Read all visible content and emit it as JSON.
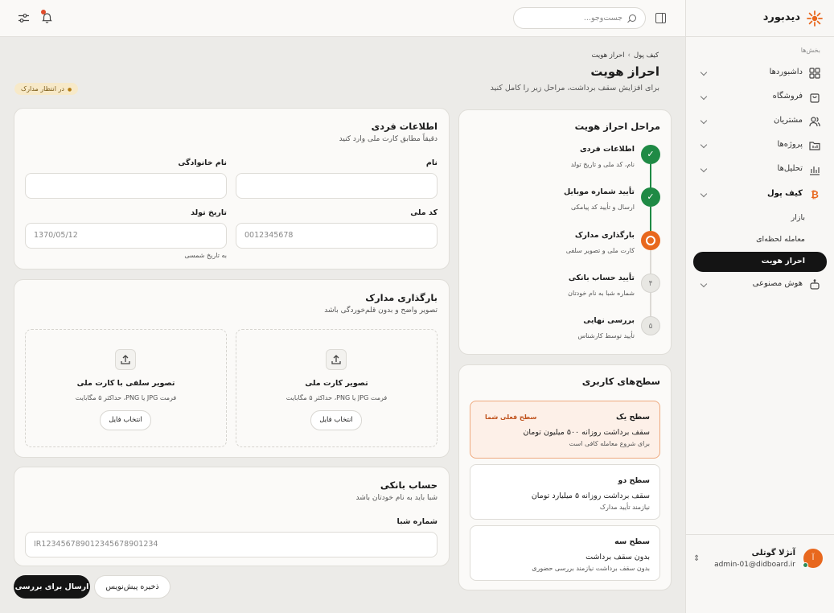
{
  "app": {
    "name": "دیدبورد"
  },
  "topbar": {
    "search_placeholder": "جست‌وجو..."
  },
  "sidebar": {
    "section": "بخش‌ها",
    "items": [
      {
        "label": "داشبوردها",
        "icon": "grid-icon"
      },
      {
        "label": "فروشگاه",
        "icon": "bag-icon"
      },
      {
        "label": "مشتریان",
        "icon": "users-icon"
      },
      {
        "label": "پروژه‌ها",
        "icon": "folder-icon"
      },
      {
        "label": "تحلیل‌ها",
        "icon": "bar-chart-icon"
      },
      {
        "label": "کیف پول",
        "icon": "bitcoin-icon"
      },
      {
        "label": "هوش مصنوعی",
        "icon": "robot-icon"
      }
    ],
    "wallet_sub": [
      {
        "label": "بازار"
      },
      {
        "label": "معامله لحظه‌ای"
      },
      {
        "label": "احراز هویت"
      }
    ],
    "user": {
      "name": "آنژلا گوتلی",
      "email": "admin-01@didboard.ir",
      "initial": "آ"
    }
  },
  "header": {
    "breadcrumb": [
      "کیف پول",
      "احراز هویت"
    ],
    "title": "احراز هویت",
    "subtitle": "برای افزایش سقف برداشت، مراحل زیر را کامل کنید",
    "status": "در انتظار مدارک"
  },
  "personal": {
    "title": "اطلاعات فردی",
    "subtitle": "دقیقاً مطابق کارت ملی وارد کنید",
    "first_name_label": "نام",
    "last_name_label": "نام خانوادگی",
    "national_id_label": "کد ملی",
    "national_id_placeholder": "0012345678",
    "birth_label": "تاریخ تولد",
    "birth_placeholder": "1370/05/12",
    "birth_hint": "به تاریخ شمسی"
  },
  "upload": {
    "title": "بارگذاری مدارک",
    "subtitle": "تصویر واضح و بدون قلم‌خوردگی باشد",
    "card1_title": "تصویر کارت ملی",
    "card1_hint": "فرمت JPG یا PNG، حداکثر ۵ مگابایت",
    "card2_title": "تصویر سلفی با کارت ملی",
    "card2_hint": "فرمت JPG یا PNG، حداکثر ۵ مگابایت",
    "choose": "انتخاب فایل"
  },
  "bank": {
    "title": "حساب بانکی",
    "subtitle": "شبا باید به نام خودتان باشد",
    "iban_label": "شماره شبا",
    "iban_placeholder": "IR123456789012345678901234"
  },
  "actions": {
    "submit": "ارسال برای بررسی",
    "draft": "ذخیره پیش‌نویس"
  },
  "steps": {
    "title": "مراحل احراز هویت",
    "items": [
      {
        "title": "اطلاعات فردی",
        "desc": "نام، کد ملی و تاریخ تولد",
        "state": "done",
        "mark": "✓"
      },
      {
        "title": "تأیید شماره موبایل",
        "desc": "ارسال و تأیید کد پیامکی",
        "state": "done",
        "mark": "✓"
      },
      {
        "title": "بارگذاری مدارک",
        "desc": "کارت ملی و تصویر سلفی",
        "state": "current",
        "mark": ""
      },
      {
        "title": "تأیید حساب بانکی",
        "desc": "شماره شبا به نام خودتان",
        "state": "pending",
        "mark": "۴"
      },
      {
        "title": "بررسی نهایی",
        "desc": "تأیید توسط کارشناس",
        "state": "pending",
        "mark": "۵"
      }
    ]
  },
  "levels": {
    "title": "سطح‌های کاربری",
    "items": [
      {
        "title": "سطح یک",
        "desc": "سقف برداشت روزانه ۵۰۰ میلیون تومان",
        "note": "برای شروع معامله کافی است",
        "badge": "سطح فعلی شما"
      },
      {
        "title": "سطح دو",
        "desc": "سقف برداشت روزانه ۵ میلیارد تومان",
        "note": "نیازمند تأیید مدارک"
      },
      {
        "title": "سطح سه",
        "desc": "بدون سقف برداشت",
        "note": "بدون سقف برداشت نیازمند بررسی حضوری"
      }
    ]
  },
  "colors": {
    "accent": "#e8681e",
    "success": "#1f8a45",
    "dark": "#141414"
  }
}
